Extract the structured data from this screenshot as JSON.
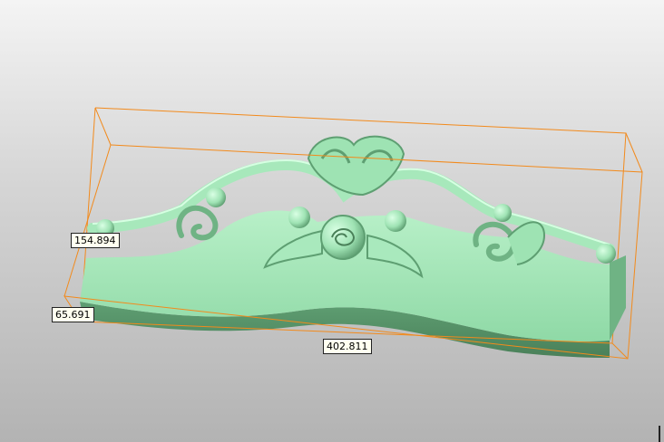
{
  "viewport": {
    "background_top": "#f4f4f4",
    "background_bottom": "#b3b3b3",
    "model_color": "#9ee3b3",
    "bounding_box_color": "#f28a1c"
  },
  "dimensions": {
    "height": "154.894",
    "depth": "65.691",
    "width": "402.811"
  }
}
